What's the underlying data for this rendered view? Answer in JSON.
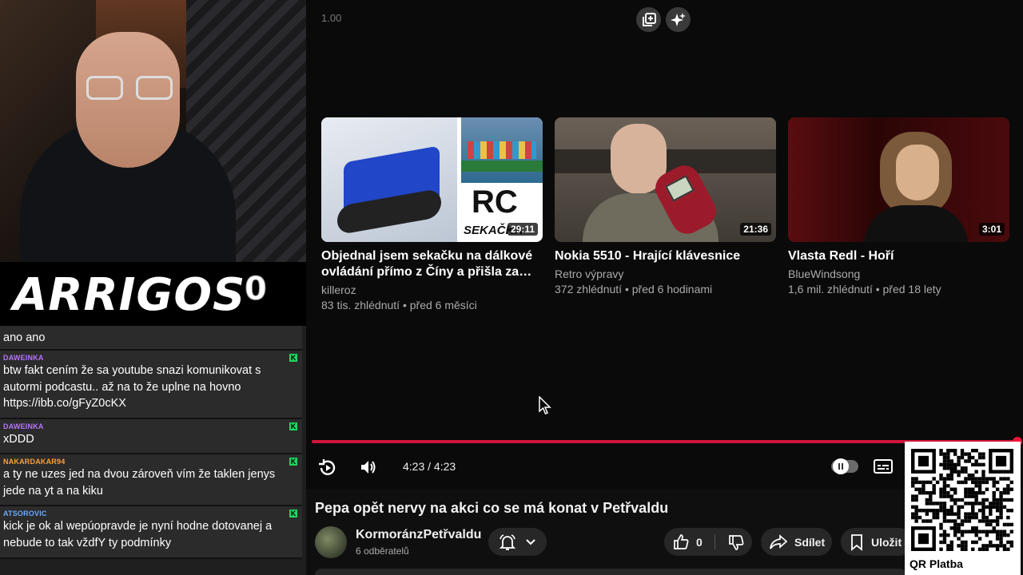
{
  "stream": {
    "logo_text": "ARRIGOS",
    "score": "0"
  },
  "chat": {
    "messages": [
      {
        "user": "",
        "user_color": "#ffffff",
        "text": "ano ano"
      },
      {
        "user": "DAWEINKA",
        "user_color": "#b673ff",
        "text": "btw fakt cením že sa youtube snazi komunikovat s autormi podcastu.. až na to že uplne na hovno https://ibb.co/gFyZ0cKX"
      },
      {
        "user": "DAWEINKA",
        "user_color": "#b673ff",
        "text": "xDDD"
      },
      {
        "user": "NAKARDAKAR94",
        "user_color": "#ff9f3a",
        "text": "a ty ne uzes jed na dvou zároveň vím že taklen jenys jede na yt a na kiku"
      },
      {
        "user": "ATSOROVIC",
        "user_color": "#6aa9ff",
        "text": "kick je ok al wepúopravde je nyní hodne dotovanej a nebude to tak vždfY ty podmínky"
      }
    ],
    "badge_color": "#1ed760"
  },
  "player": {
    "speed": "1.00",
    "progress": 1.0,
    "time": "4:23 / 4:23",
    "accent_color": "#d0153b",
    "icons": [
      "playlist-add-icon",
      "sparkle-icon",
      "replay-icon",
      "volume-icon",
      "autoplay-pause-icon",
      "subtitles-icon"
    ]
  },
  "related": [
    {
      "title": "Objednal jsem sekačku na dálkové ovládání přímo z Číny a přišla za dva...",
      "channel": "killeroz",
      "meta": "83 tis. zhlédnutí • před 6 měsíci",
      "duration": "29:11",
      "thumb_text": "RC",
      "thumb_subtext": "SEKAČKA"
    },
    {
      "title": "Nokia 5510 - Hrající klávesnice",
      "channel": "Retro výpravy",
      "meta": "372 zhlédnutí • před 6 hodinami",
      "duration": "21:36"
    },
    {
      "title": "Vlasta Redl - Hoří",
      "channel": "BlueWindsong",
      "meta": "1,6 mil. zhlédnutí • před 18 lety",
      "duration": "3:01"
    }
  ],
  "video": {
    "title": "Pepa opět nervy na akci co se má konat v Petřvaldu",
    "channel_name": "KormoránzPetřvaldu",
    "subscribers": "6 odběratelů",
    "likes": "0",
    "share_label": "Sdílet",
    "save_label": "Uložit"
  },
  "qr": {
    "label": "QR Platba"
  }
}
